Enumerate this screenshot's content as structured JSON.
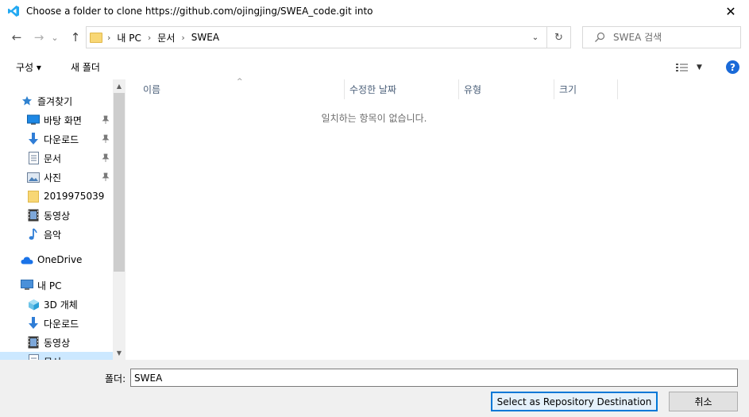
{
  "window": {
    "title": "Choose a folder to clone https://github.com/ojingjing/SWEA_code.git into",
    "close_glyph": "✕",
    "app_icon": "vscode-icon"
  },
  "navigation": {
    "back_glyph": "←",
    "forward_glyph": "→",
    "recent_glyph": "⌄",
    "up_glyph": "↑"
  },
  "address": {
    "breadcrumbs": [
      "내 PC",
      "문서",
      "SWEA"
    ],
    "separator": "›",
    "dropdown_glyph": "⌄",
    "refresh_glyph": "↻"
  },
  "search": {
    "placeholder": "SWEA 검색"
  },
  "toolbar": {
    "organize_label": "구성 ▾",
    "new_folder_label": "새 폴더",
    "help_label": "?"
  },
  "sidebar": {
    "items": [
      {
        "label": "즐겨찾기",
        "icon": "star-icon",
        "pinned": false
      },
      {
        "label": "바탕 화면",
        "icon": "desktop-icon",
        "pinned": true
      },
      {
        "label": "다운로드",
        "icon": "download-icon",
        "pinned": true
      },
      {
        "label": "문서",
        "icon": "document-icon",
        "pinned": true
      },
      {
        "label": "사진",
        "icon": "pictures-icon",
        "pinned": true
      },
      {
        "label": "2019975039",
        "icon": "folder-icon",
        "pinned": false
      },
      {
        "label": "동영상",
        "icon": "video-icon",
        "pinned": false
      },
      {
        "label": "음악",
        "icon": "music-icon",
        "pinned": false
      },
      {
        "label": "OneDrive",
        "icon": "cloud-icon",
        "pinned": false
      },
      {
        "label": "내 PC",
        "icon": "computer-icon",
        "pinned": false
      },
      {
        "label": "3D 개체",
        "icon": "cube-icon",
        "pinned": false
      },
      {
        "label": "다운로드",
        "icon": "download-icon",
        "pinned": false
      },
      {
        "label": "동영상",
        "icon": "video-icon",
        "pinned": false
      },
      {
        "label": "문서",
        "icon": "document-icon",
        "pinned": false
      }
    ],
    "scroll_up_glyph": "▲",
    "scroll_down_glyph": "▼"
  },
  "content": {
    "columns": [
      "이름",
      "수정한 날짜",
      "유형",
      "크기"
    ],
    "sort_glyph": "^",
    "empty_message": "일치하는 항목이 없습니다."
  },
  "footer": {
    "folder_label": "폴더:",
    "folder_value": "SWEA",
    "confirm_label": "Select as Repository Destination",
    "cancel_label": "취소"
  },
  "colors": {
    "accent": "#0078d7",
    "selection": "#cce8ff",
    "folder_yellow": "#f8d775",
    "vscode_blue": "#23a9f2"
  }
}
